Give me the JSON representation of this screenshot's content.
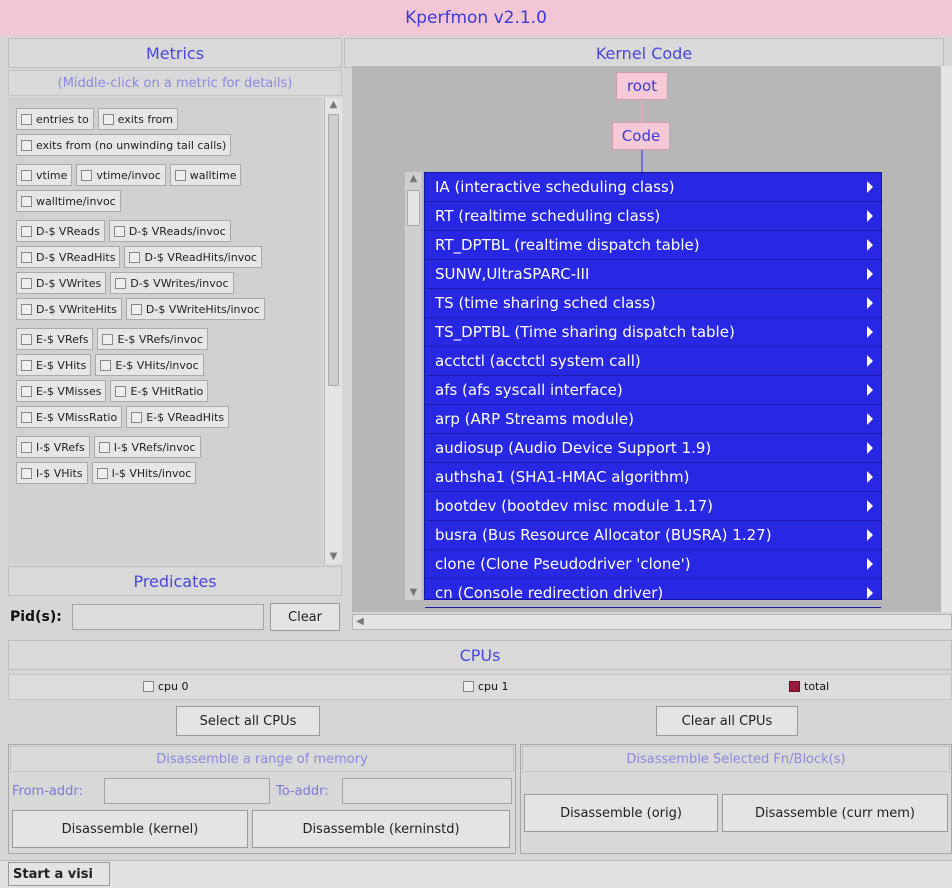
{
  "app": {
    "title": "Kperfmon v2.1.0"
  },
  "metrics": {
    "header": "Metrics",
    "hint": "(Middle-click on a metric for details)",
    "groups": [
      [
        [
          "entries to",
          "exits from"
        ],
        [
          "exits from (no unwinding tail calls)"
        ]
      ],
      [
        [
          "vtime",
          "vtime/invoc",
          "walltime"
        ],
        [
          "walltime/invoc"
        ]
      ],
      [
        [
          "D-$ VReads",
          "D-$ VReads/invoc"
        ],
        [
          "D-$ VReadHits",
          "D-$ VReadHits/invoc"
        ],
        [
          "D-$ VWrites",
          "D-$ VWrites/invoc"
        ],
        [
          "D-$ VWriteHits",
          "D-$ VWriteHits/invoc"
        ]
      ],
      [
        [
          "E-$ VRefs",
          "E-$ VRefs/invoc"
        ],
        [
          "E-$ VHits",
          "E-$ VHits/invoc"
        ],
        [
          "E-$ VMisses",
          "E-$ VHitRatio"
        ],
        [
          "E-$ VMissRatio",
          "E-$ VReadHits"
        ]
      ],
      [
        [
          "I-$ VRefs",
          "I-$ VRefs/invoc"
        ],
        [
          "I-$ VHits",
          "I-$ VHits/invoc"
        ]
      ]
    ]
  },
  "predicates": {
    "header": "Predicates",
    "pid_label": "Pid(s):",
    "pid_value": "",
    "clear_label": "Clear"
  },
  "kernel": {
    "header": "Kernel Code",
    "root_label": "root",
    "code_label": "Code",
    "items": [
      "IA (interactive scheduling class)",
      "RT (realtime scheduling class)",
      "RT_DPTBL (realtime dispatch table)",
      "SUNW,UltraSPARC-III",
      "TS (time sharing sched class)",
      "TS_DPTBL (Time sharing dispatch table)",
      "acctctl (acctctl system call)",
      "afs (afs syscall interface)",
      "arp (ARP Streams module)",
      "audiosup (Audio Device Support 1.9)",
      "authsha1 (SHA1-HMAC algorithm)",
      "bootdev (bootdev misc module 1.17)",
      "busra (Bus Resource Allocator (BUSRA) 1.27)",
      "clone (Clone Pseudodriver 'clone')",
      "cn (Console redirection driver)"
    ]
  },
  "cpus": {
    "header": "CPUs",
    "options": [
      {
        "label": "cpu 0",
        "checked": false
      },
      {
        "label": "cpu 1",
        "checked": false
      },
      {
        "label": "total",
        "checked": true
      }
    ],
    "select_all_label": "Select all CPUs",
    "clear_all_label": "Clear all CPUs"
  },
  "disasm_range": {
    "header": "Disassemble a range of memory",
    "from_label": "From-addr:",
    "from_value": "",
    "to_label": "To-addr:",
    "to_value": "",
    "kernel_btn": "Disassemble (kernel)",
    "kerninstd_btn": "Disassemble (kerninstd)"
  },
  "disasm_selected": {
    "header": "Disassemble Selected Fn/Block(s)",
    "orig_btn": "Disassemble (orig)",
    "curr_btn": "Disassemble (curr mem)"
  },
  "footer": {
    "start_label": "Start a visi"
  },
  "colors": {
    "accent": "#3b3ad8",
    "menu_bg": "#2828e4",
    "node_bg": "#f6c9d6",
    "checked": "#9b1b3d"
  }
}
